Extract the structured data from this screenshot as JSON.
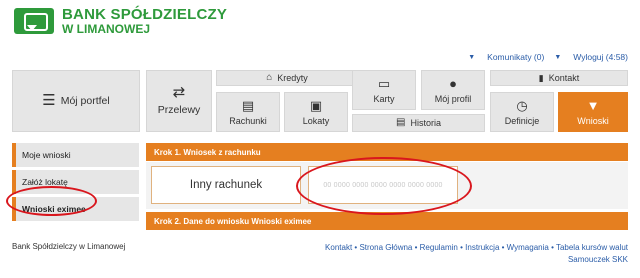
{
  "brand": {
    "line1": "BANK SPÓŁDZIELCZY",
    "line2": "W LIMANOWEJ",
    "color": "#2e9a3b"
  },
  "topbar": {
    "messages": "Komunikaty (0)",
    "logout": "Wyloguj (4:58)"
  },
  "menu": {
    "portfolio": "Mój portfel",
    "transfers": "Przelewy",
    "credits": "Kredyty",
    "accounts": "Rachunki",
    "deposits": "Lokaty",
    "history": "Historia",
    "cards": "Karty",
    "profile": "Mój profil",
    "contact": "Kontakt",
    "definitions": "Definicje",
    "applications": "Wnioski"
  },
  "sidebar": {
    "items": [
      {
        "label": "Moje wnioski"
      },
      {
        "label": "Załóż lokatę"
      },
      {
        "label": "Wnioski eximee"
      }
    ]
  },
  "content": {
    "step1": "Krok 1. Wniosek z rachunku",
    "other_account": "Inny rachunek",
    "account_placeholder": "00 0000 0000 0000 0000 0000 0000",
    "step2": "Krok 2. Dane do wniosku Wnioski eximee"
  },
  "footer": {
    "bank": "Bank Spółdzielczy w Limanowej",
    "links": [
      "Kontakt",
      "Strona Główna",
      "Regulamin",
      "Instrukcja",
      "Wymagania",
      "Tabela kursów walut"
    ],
    "extra": "Samouczek SKK"
  },
  "colors": {
    "accent": "#e57f20",
    "link": "#2b5da8",
    "annotation": "#d9161d"
  }
}
